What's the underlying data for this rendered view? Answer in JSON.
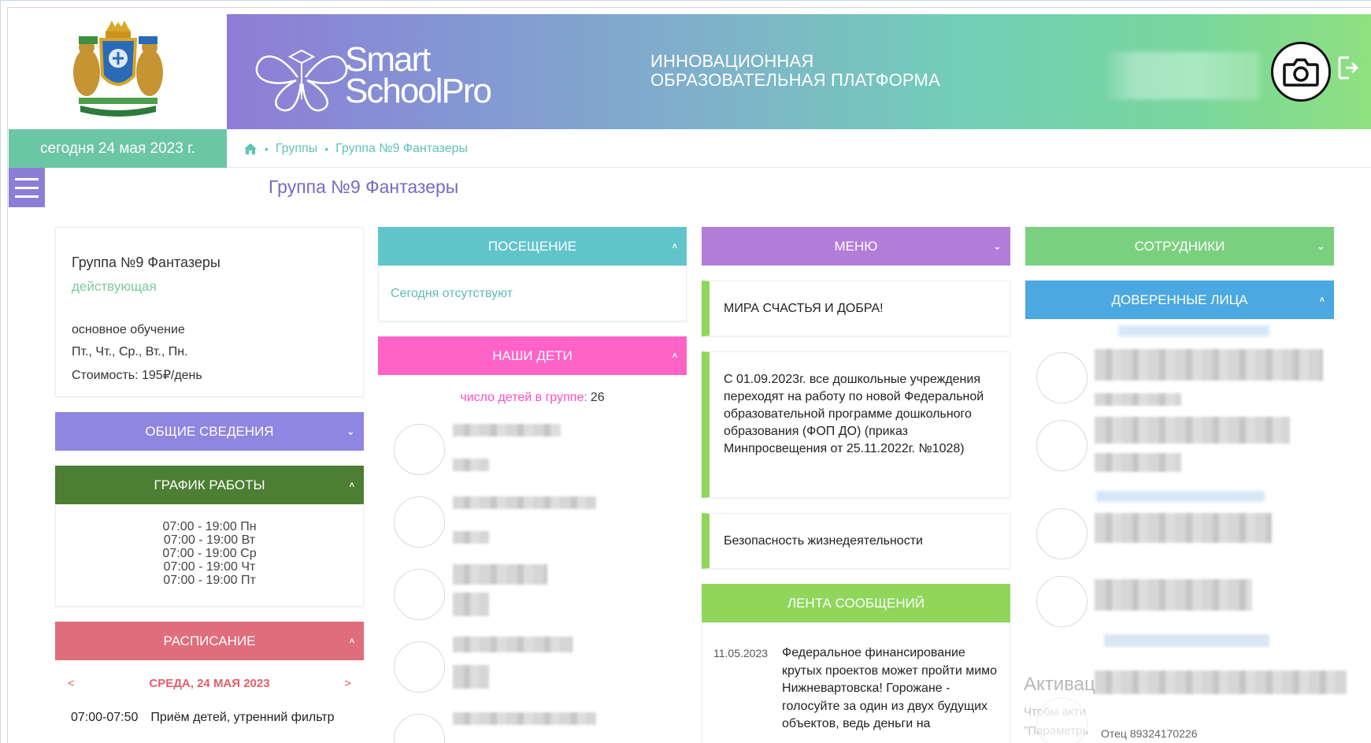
{
  "header": {
    "logo_line1": "Smart",
    "logo_line2": "SchoolPro",
    "platform_title_line1": "ИННОВАЦИОННАЯ",
    "platform_title_line2": "ОБРАЗОВАТЕЛЬНАЯ ПЛАТФОРМА",
    "avatar_icon": "camera-icon",
    "exit_icon": "logout-icon"
  },
  "date_label": "сегодня 24 мая 2023 г.",
  "breadcrumb": {
    "home_icon": "home-icon",
    "items": [
      "Группы",
      "Группа №9 Фантазеры"
    ]
  },
  "page_title": "Группа №9 Фантазеры",
  "group_card": {
    "name": "Группа №9 Фантазеры",
    "state": "действующая",
    "type": "основное обучение",
    "days": "Пт., Чт., Ср., Вт., Пн.",
    "cost": "Стоимость: 195₽/день"
  },
  "panels": {
    "info": "ОБЩИЕ СВЕДЕНИЯ",
    "schedule": "ГРАФИК РАБОТЫ",
    "timetable": "РАСПИСАНИЕ",
    "visits": "ПОСЕЩЕНИЕ",
    "kids": "НАШИ ДЕТИ",
    "menu": "МЕНЮ",
    "feed": "ЛЕНТА СООБЩЕНИЙ",
    "staff": "СОТРУДНИКИ",
    "trusted": "ДОВЕРЕННЫЕ ЛИЦА"
  },
  "chevrons": {
    "down": "⌄",
    "up": "˄"
  },
  "schedule_rows": [
    "07:00 - 19:00 Пн",
    "07:00 - 19:00 Вт",
    "07:00 - 19:00 Ср",
    "07:00 - 19:00 Чт",
    "07:00 - 19:00 Пт"
  ],
  "timetable": {
    "prev": "<",
    "day": "СРЕДА, 24 МАЯ 2023",
    "next": ">",
    "time": "07:00-07:50",
    "activity": "Приём детей, утренний фильтр"
  },
  "visits_text": "Сегодня отсутствуют",
  "kids_count_label": "число детей в группе:",
  "kids_count": "26",
  "news": [
    "МИРА СЧАСТЬЯ И ДОБРА!",
    "С 01.09.2023г. все дошкольные учреждения переходят на работу по новой Федеральной образовательной программе дошкольного образования (ФОП ДО) (приказ Минпросвещения от 25.11.2022г. №1028)",
    "Безопасность жизнедеятельности"
  ],
  "feed": {
    "date": "11.05.2023",
    "text": "Федеральное финансирование крутых проектов может пройти мимо Нижневартовска! Горожане - голосуйте за один из двух будущих объектов, ведь деньги на"
  },
  "windows_watermark": {
    "title": "Активац",
    "line1": "Чтобы акти",
    "line2": "\"Параметрь"
  },
  "trusted_last": "Отец 89324170226",
  "colors": {
    "accent_purple": "#8c7ed6",
    "teal": "#6bc6a6",
    "pink": "#ff63c6",
    "green_dark": "#4c7e33",
    "red": "#e06d7b",
    "blue": "#4ba8e0",
    "lime": "#8fd65b"
  }
}
